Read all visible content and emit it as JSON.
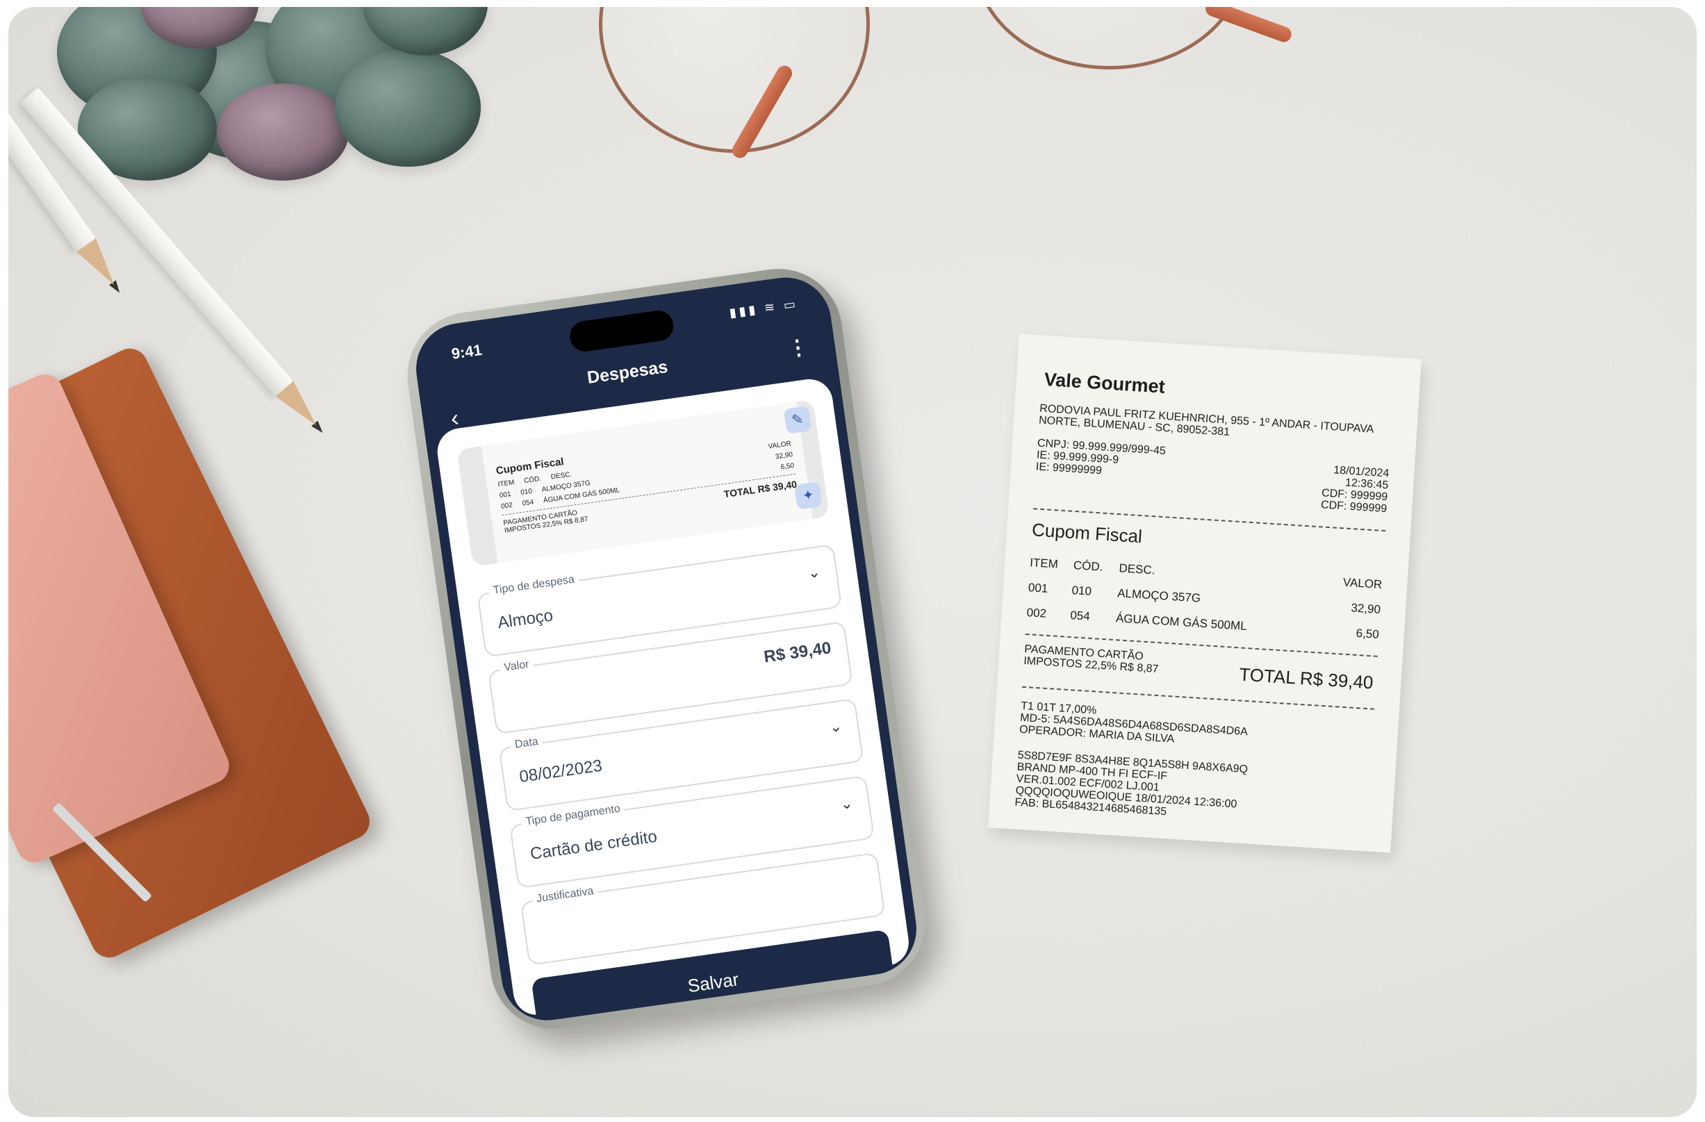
{
  "phone": {
    "status_time": "9:41",
    "header_title": "Despesas",
    "receipt_preview": {
      "title": "Cupom Fiscal",
      "columns": [
        "ITEM",
        "CÓD.",
        "DESC.",
        "VALOR"
      ],
      "rows": [
        {
          "item": "001",
          "cod": "010",
          "desc": "ALMOÇO 357G",
          "valor": "32,90"
        },
        {
          "item": "002",
          "cod": "054",
          "desc": "ÁGUA COM GÁS 500ML",
          "valor": "6,50"
        }
      ],
      "payment_line": "PAGAMENTO CARTÃO",
      "taxes_line": "IMPOSTOS 22,5% R$ 8,87",
      "total": "TOTAL R$ 39,40",
      "edit_icon": "pencil-icon",
      "magic_icon": "magic-wand-icon"
    },
    "form": {
      "expense_type": {
        "label": "Tipo de despesa",
        "value": "Almoço"
      },
      "amount": {
        "label": "Valor",
        "value": "R$ 39,40"
      },
      "date": {
        "label": "Data",
        "value": "08/02/2023"
      },
      "payment_type": {
        "label": "Tipo de pagamento",
        "value": "Cartão de crédito"
      },
      "justification": {
        "label": "Justificativa",
        "value": ""
      },
      "save_label": "Salvar"
    }
  },
  "receipt": {
    "store": "Vale Gourmet",
    "address": "RODOVIA PAUL FRITZ KUEHNRICH, 955 - 1º ANDAR - ITOUPAVA NORTE, BLUMENAU - SC, 89052-381",
    "cnpj": "CNPJ: 99.999.999/999-45",
    "ie1": "IE: 99.999.999-9",
    "ie2": "IE: 99999999",
    "date": "18/01/2024",
    "time": "12:36:45",
    "cdf1": "CDF: 999999",
    "cdf2": "CDF: 999999",
    "title": "Cupom Fiscal",
    "columns": [
      "ITEM",
      "CÓD.",
      "DESC.",
      "VALOR"
    ],
    "rows": [
      {
        "item": "001",
        "cod": "010",
        "desc": "ALMOÇO 357G",
        "valor": "32,90"
      },
      {
        "item": "002",
        "cod": "054",
        "desc": "ÁGUA COM GÁS 500ML",
        "valor": "6,50"
      }
    ],
    "payment": "PAGAMENTO CARTÃO",
    "taxes": "IMPOSTOS 22,5% R$ 8,87",
    "total": "TOTAL R$ 39,40",
    "footer_lines": [
      "T1 01T 17,00%",
      "MD-5: 5A4S6DA48S6D4A68SD6SDA8S4D6A",
      "OPERADOR: MARIA DA SILVA",
      "5S8D7E9F 8S3A4H8E 8Q1A5S8H 9A8X6A9Q",
      "BRAND MP-400 TH FI ECF-IF",
      "VER.01.002 ECF/002 LJ.001",
      "QQQQIOQUWEOIQUE 18/01/2024 12:36:00",
      "FAB: BL654843214685468135"
    ]
  }
}
